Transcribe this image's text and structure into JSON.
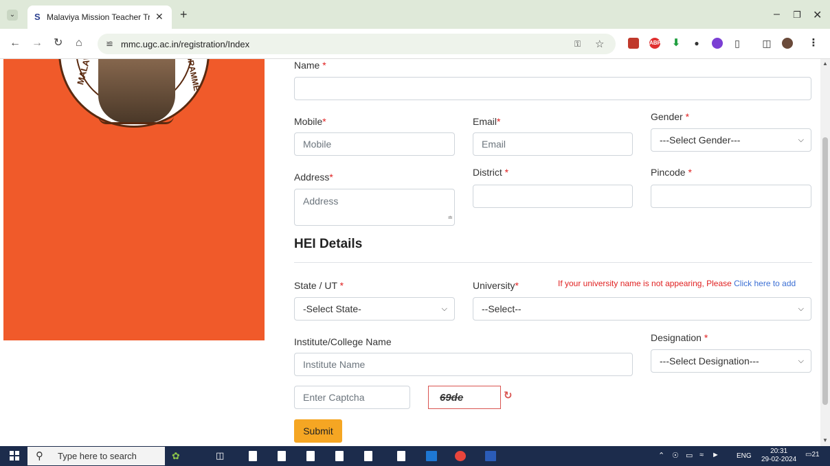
{
  "browser": {
    "tab_title": "Malaviya Mission Teacher Traini",
    "url": "mmc.ugc.ac.in/registration/Index"
  },
  "logo": {
    "text_left": "MALAVIYA",
    "text_right": "OGRAMME"
  },
  "form": {
    "name_label": "Name",
    "mobile_label": "Mobile",
    "mobile_placeholder": "Mobile",
    "email_label": "Email",
    "email_placeholder": "Email",
    "gender_label": "Gender",
    "gender_value": "---Select Gender---",
    "address_label": "Address",
    "address_placeholder": "Address",
    "district_label": "District",
    "pincode_label": "Pincode",
    "required_mark": "*"
  },
  "hei": {
    "title": "HEI Details",
    "state_label": "State / UT",
    "state_value": "-Select State-",
    "university_label": "University",
    "university_value": "--Select--",
    "notice_text": "If your university name is not appearing, Please ",
    "notice_link": "Click here to add",
    "institute_label": "Institute/College Name",
    "institute_placeholder": "Institute Name",
    "designation_label": "Designation",
    "designation_value": "---Select Designation---",
    "captcha_placeholder": "Enter Captcha",
    "captcha_text": "69de",
    "submit_label": "Submit"
  },
  "taskbar": {
    "search_placeholder": "Type here to search",
    "lang": "ENG",
    "time": "20:31",
    "date": "29-02-2024",
    "notifications": "21"
  }
}
